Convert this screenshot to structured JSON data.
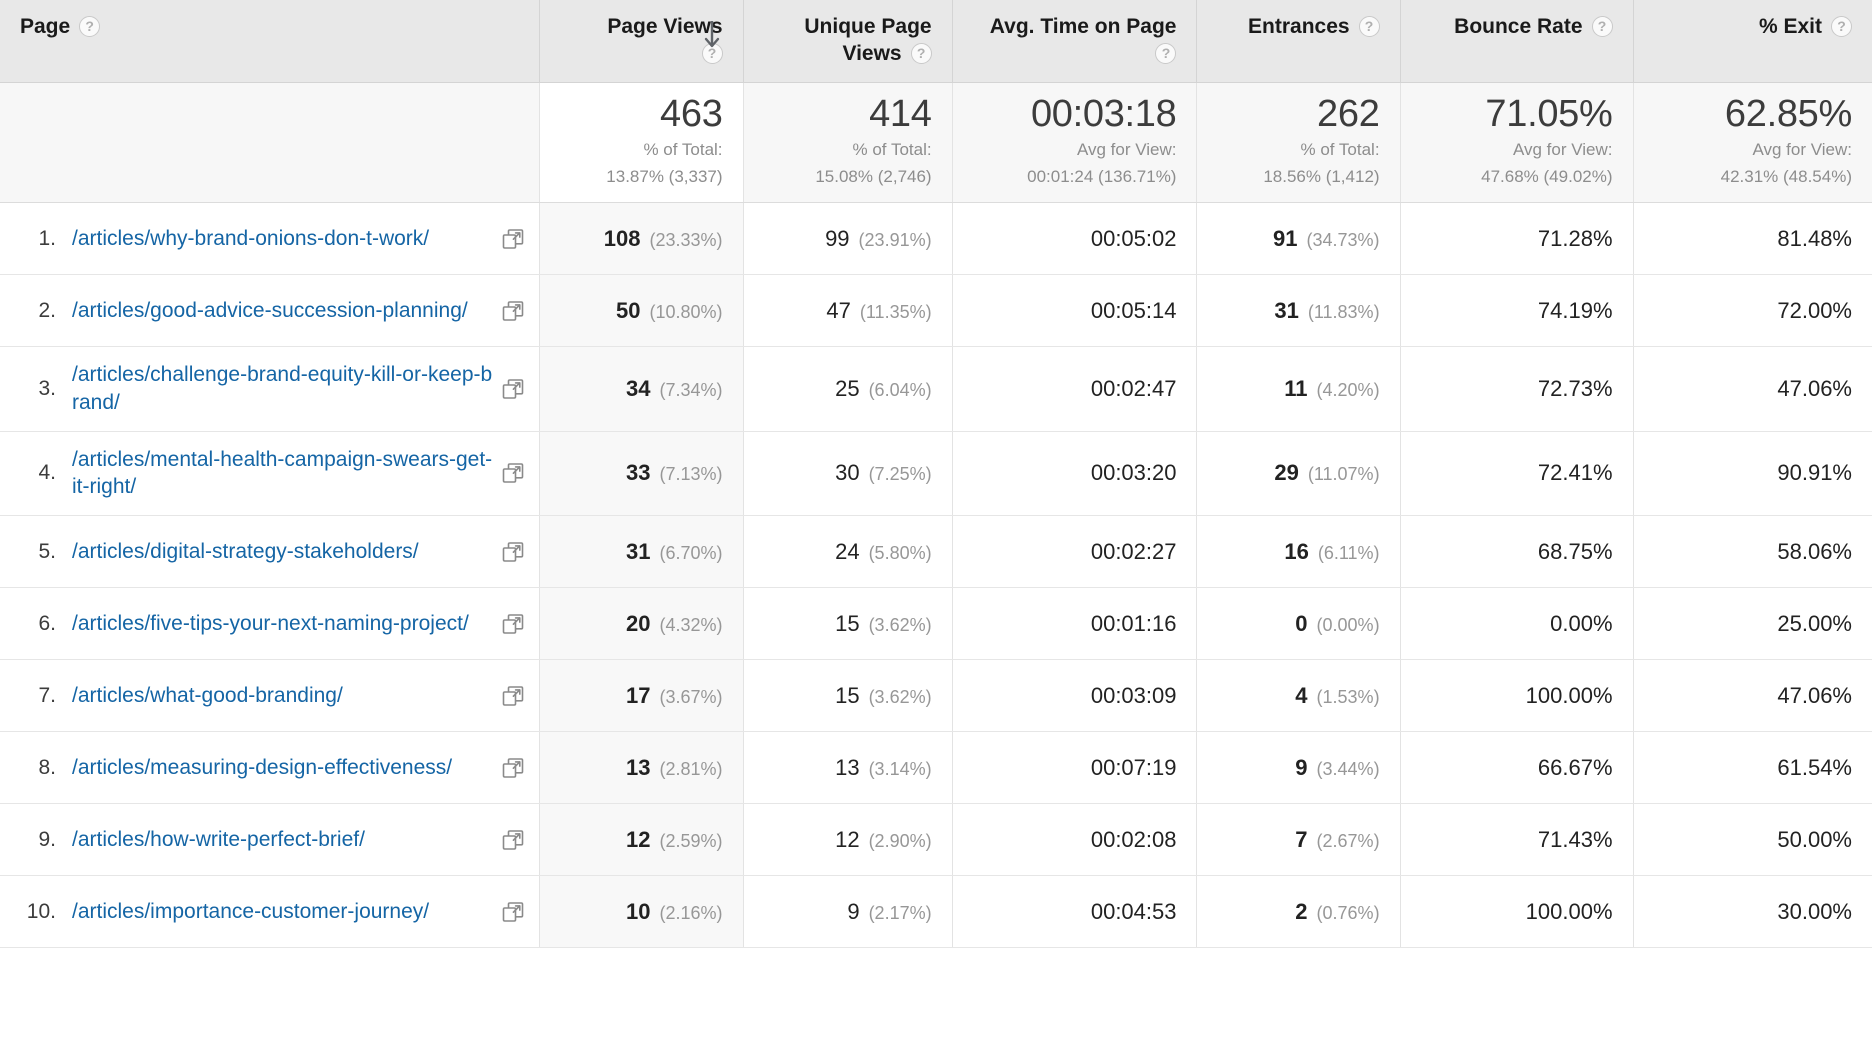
{
  "table": {
    "columns": [
      {
        "key": "page",
        "label": "Page",
        "help": "?",
        "align": "left",
        "sorted": false
      },
      {
        "key": "pageviews",
        "label": "Page Views",
        "help": "?",
        "align": "right",
        "sorted": true,
        "sort_direction": "descending",
        "sort_arrow": "arrow-down-icon"
      },
      {
        "key": "uniquepv",
        "label": "Unique Page Views",
        "help": "?",
        "align": "right",
        "sorted": false
      },
      {
        "key": "avgtime",
        "label": "Avg. Time on Page",
        "help": "?",
        "align": "right",
        "sorted": false
      },
      {
        "key": "entrances",
        "label": "Entrances",
        "help": "?",
        "align": "right",
        "sorted": false
      },
      {
        "key": "bounce",
        "label": "Bounce Rate",
        "help": "?",
        "align": "right",
        "sorted": false
      },
      {
        "key": "exit",
        "label": "% Exit",
        "help": "?",
        "align": "right",
        "sorted": false
      }
    ],
    "summary": {
      "page": {
        "value": "",
        "sub_label": "",
        "sub_value": ""
      },
      "pageviews": {
        "value": "463",
        "sub_label": "% of Total:",
        "sub_value": "13.87% (3,337)"
      },
      "uniquepv": {
        "value": "414",
        "sub_label": "% of Total:",
        "sub_value": "15.08% (2,746)"
      },
      "avgtime": {
        "value": "00:03:18",
        "sub_label": "Avg for View:",
        "sub_value": "00:01:24 (136.71%)"
      },
      "entrances": {
        "value": "262",
        "sub_label": "% of Total:",
        "sub_value": "18.56% (1,412)"
      },
      "bounce": {
        "value": "71.05%",
        "sub_label": "Avg for View:",
        "sub_value": "47.68% (49.02%)"
      },
      "exit": {
        "value": "62.85%",
        "sub_label": "Avg for View:",
        "sub_value": "42.31% (48.54%)"
      }
    },
    "rows": [
      {
        "index": "1.",
        "page": "/articles/why-brand-onions-don-t-work/",
        "link_icon": "external-link-icon",
        "pageviews": "108",
        "pageviews_pct": "(23.33%)",
        "uniquepv": "99",
        "uniquepv_pct": "(23.91%)",
        "avgtime": "00:05:02",
        "entrances": "91",
        "entrances_pct": "(34.73%)",
        "bounce": "71.28%",
        "exit": "81.48%"
      },
      {
        "index": "2.",
        "page": "/articles/good-advice-succession-planning/",
        "link_icon": "external-link-icon",
        "pageviews": "50",
        "pageviews_pct": "(10.80%)",
        "uniquepv": "47",
        "uniquepv_pct": "(11.35%)",
        "avgtime": "00:05:14",
        "entrances": "31",
        "entrances_pct": "(11.83%)",
        "bounce": "74.19%",
        "exit": "72.00%"
      },
      {
        "index": "3.",
        "page": "/articles/challenge-brand-equity-kill-or-keep-brand/",
        "link_icon": "external-link-icon",
        "pageviews": "34",
        "pageviews_pct": "(7.34%)",
        "uniquepv": "25",
        "uniquepv_pct": "(6.04%)",
        "avgtime": "00:02:47",
        "entrances": "11",
        "entrances_pct": "(4.20%)",
        "bounce": "72.73%",
        "exit": "47.06%"
      },
      {
        "index": "4.",
        "page": "/articles/mental-health-campaign-swears-get-it-right/",
        "link_icon": "external-link-icon",
        "pageviews": "33",
        "pageviews_pct": "(7.13%)",
        "uniquepv": "30",
        "uniquepv_pct": "(7.25%)",
        "avgtime": "00:03:20",
        "entrances": "29",
        "entrances_pct": "(11.07%)",
        "bounce": "72.41%",
        "exit": "90.91%"
      },
      {
        "index": "5.",
        "page": "/articles/digital-strategy-stakeholders/",
        "link_icon": "external-link-icon",
        "pageviews": "31",
        "pageviews_pct": "(6.70%)",
        "uniquepv": "24",
        "uniquepv_pct": "(5.80%)",
        "avgtime": "00:02:27",
        "entrances": "16",
        "entrances_pct": "(6.11%)",
        "bounce": "68.75%",
        "exit": "58.06%"
      },
      {
        "index": "6.",
        "page": "/articles/five-tips-your-next-naming-project/",
        "link_icon": "external-link-icon",
        "pageviews": "20",
        "pageviews_pct": "(4.32%)",
        "uniquepv": "15",
        "uniquepv_pct": "(3.62%)",
        "avgtime": "00:01:16",
        "entrances": "0",
        "entrances_pct": "(0.00%)",
        "bounce": "0.00%",
        "exit": "25.00%"
      },
      {
        "index": "7.",
        "page": "/articles/what-good-branding/",
        "link_icon": "external-link-icon",
        "pageviews": "17",
        "pageviews_pct": "(3.67%)",
        "uniquepv": "15",
        "uniquepv_pct": "(3.62%)",
        "avgtime": "00:03:09",
        "entrances": "4",
        "entrances_pct": "(1.53%)",
        "bounce": "100.00%",
        "exit": "47.06%"
      },
      {
        "index": "8.",
        "page": "/articles/measuring-design-effectiveness/",
        "link_icon": "external-link-icon",
        "pageviews": "13",
        "pageviews_pct": "(2.81%)",
        "uniquepv": "13",
        "uniquepv_pct": "(3.14%)",
        "avgtime": "00:07:19",
        "entrances": "9",
        "entrances_pct": "(3.44%)",
        "bounce": "66.67%",
        "exit": "61.54%"
      },
      {
        "index": "9.",
        "page": "/articles/how-write-perfect-brief/",
        "link_icon": "external-link-icon",
        "pageviews": "12",
        "pageviews_pct": "(2.59%)",
        "uniquepv": "12",
        "uniquepv_pct": "(2.90%)",
        "avgtime": "00:02:08",
        "entrances": "7",
        "entrances_pct": "(2.67%)",
        "bounce": "71.43%",
        "exit": "50.00%"
      },
      {
        "index": "10.",
        "page": "/articles/importance-customer-journey/",
        "link_icon": "external-link-icon",
        "pageviews": "10",
        "pageviews_pct": "(2.16%)",
        "uniquepv": "9",
        "uniquepv_pct": "(2.17%)",
        "avgtime": "00:04:53",
        "entrances": "2",
        "entrances_pct": "(0.76%)",
        "bounce": "100.00%",
        "exit": "30.00%"
      }
    ]
  },
  "colors": {
    "link": "#1565a5",
    "header_bg": "#e8e8e8",
    "sorted_col_bg": "#f8f8f8",
    "muted_text": "#979797"
  }
}
